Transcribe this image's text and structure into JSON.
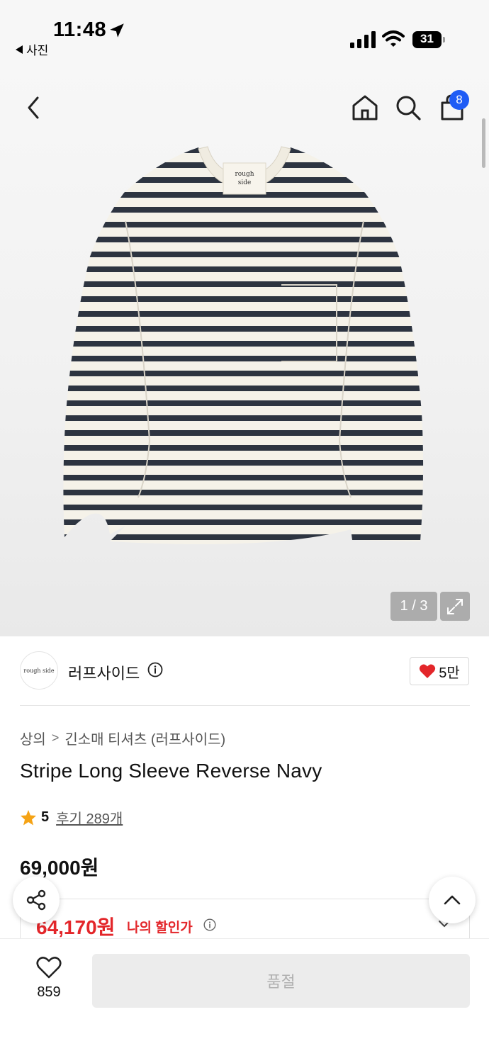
{
  "status_bar": {
    "time": "11:48",
    "back_app": "사진",
    "battery": "31"
  },
  "header": {
    "icons": [
      "back-arrow-icon",
      "home-icon",
      "search-icon",
      "shopping-bag-icon"
    ],
    "cart_count": "8"
  },
  "gallery": {
    "counter": "1 / 3",
    "label_on_garment": [
      "rough",
      "side"
    ]
  },
  "brand": {
    "logo_text": "rough side",
    "name": "러프사이드",
    "likes": "5만"
  },
  "product": {
    "breadcrumb": [
      "상의",
      "긴소매 티셔츠 (러프사이드)"
    ],
    "title": "Stripe Long Sleeve Reverse Navy",
    "rating": "5",
    "reviews": "후기 289개",
    "price": "69,000원",
    "discount_price": "64,170원",
    "discount_label": "나의 할인가"
  },
  "bottom_bar": {
    "wish_count": "859",
    "buy_button": "품절"
  },
  "colors": {
    "accent_blue": "#1f5cf5",
    "discount_red": "#e3262a",
    "stripe_navy": "#2d3440",
    "garment_cream": "#f5f2e9"
  }
}
